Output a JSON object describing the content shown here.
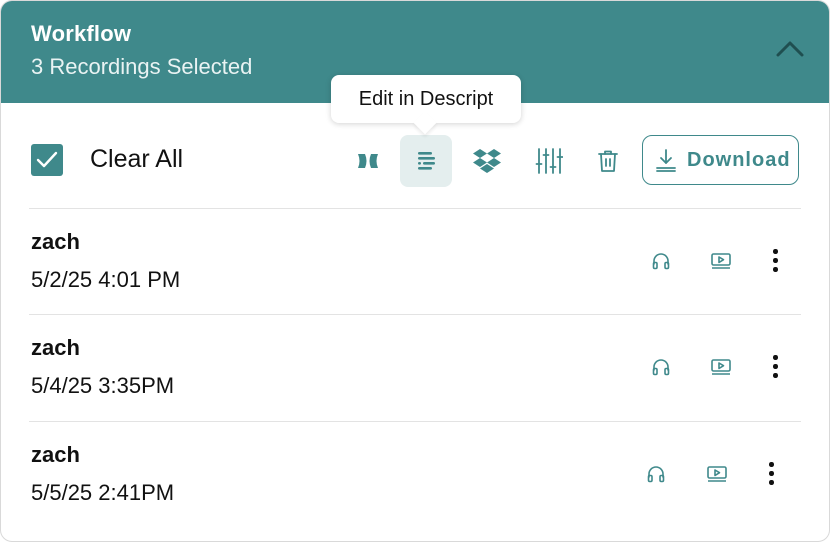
{
  "header": {
    "title": "Workflow",
    "subtitle": "3 Recordings Selected"
  },
  "toolbar": {
    "clear_all_label": "Clear All",
    "download_label": "Download",
    "tooltip": "Edit in Descript",
    "tools": [
      "descript-bowtie-icon",
      "descript-edit-icon",
      "dropbox-icon",
      "sliders-icon",
      "trash-icon"
    ]
  },
  "recordings": [
    {
      "name": "zach",
      "date": "5/2/25 4:01 PM"
    },
    {
      "name": "zach",
      "date": "5/4/25 3:35PM"
    },
    {
      "name": "zach",
      "date": "5/5/25 2:41PM"
    }
  ],
  "colors": {
    "accent": "#3f898b",
    "active_tool_bg": "#e4eeee",
    "divider": "#e3e3e3"
  }
}
